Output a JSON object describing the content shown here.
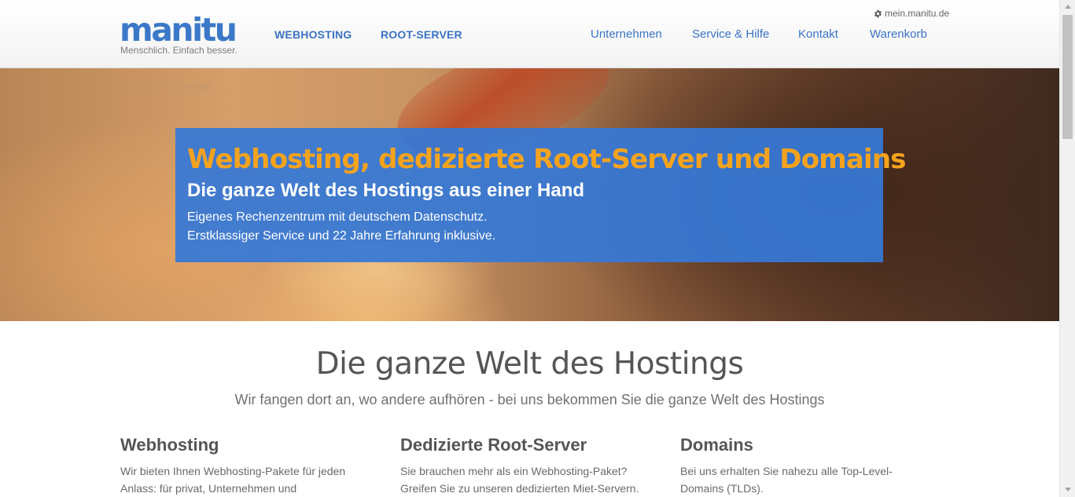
{
  "header": {
    "logo_text": "manitu",
    "logo_tagline": "Menschlich. Einfach besser.",
    "nav_primary": [
      "WEBHOSTING",
      "ROOT-SERVER"
    ],
    "nav_secondary": [
      "Unternehmen",
      "Service & Hilfe",
      "Kontakt",
      "Warenkorb"
    ],
    "account_link": "mein.manitu.de",
    "account_icon": "gear-icon",
    "link_color": "#3a73c4"
  },
  "breadcrumb": {
    "home": "manitu.de",
    "separator": "›",
    "current": "Startseite"
  },
  "hero": {
    "title": "Webhosting, dedizierte Root-Server und Domains",
    "subtitle": "Die ganze Welt des Hostings aus einer Hand",
    "line1": "Eigenes Rechenzentrum mit deutschem Datenschutz.",
    "line2": "Erstklassiger Service und 22 Jahre Erfahrung inklusive.",
    "box_color": "#3678d6",
    "title_color": "#f5a31e"
  },
  "main": {
    "heading": "Die ganze Welt des Hostings",
    "subheading": "Wir fangen dort an, wo andere aufhören - bei uns bekommen Sie die ganze Welt des Hostings",
    "columns": [
      {
        "title": "Webhosting",
        "text": "Wir bieten Ihnen Webhosting-Pakete für jeden Anlass: für privat, Unternehmen und"
      },
      {
        "title": "Dedizierte Root-Server",
        "text": "Sie brauchen mehr als ein Webhosting-Paket? Greifen Sie zu unseren dedizierten Miet-Servern."
      },
      {
        "title": "Domains",
        "text": "Bei uns erhalten Sie nahezu alle Top-Level-Domains (TLDs)."
      }
    ]
  }
}
